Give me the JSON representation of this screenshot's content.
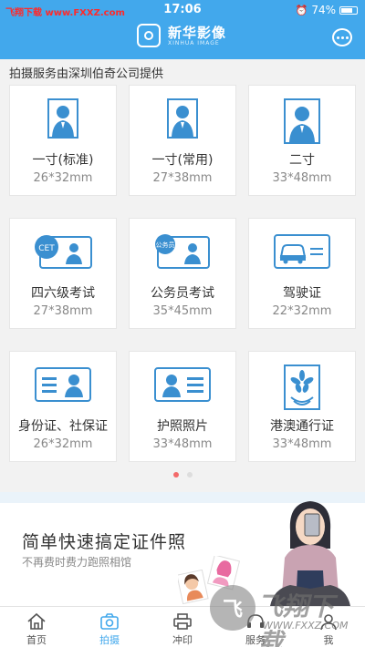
{
  "status_bar": {
    "watermark": "飞翔下载 www.FXXZ.com",
    "time": "17:06",
    "battery": "74%",
    "battery_level": 0.74
  },
  "header": {
    "logo_cn": "新华影像",
    "logo_en": "XINHUA IMAGE"
  },
  "provider_text": "拍摄服务由深圳伯奇公司提供",
  "cards": [
    {
      "title": "一寸(标准)",
      "size": "26*32mm",
      "icon": "person-portrait-icon"
    },
    {
      "title": "一寸(常用)",
      "size": "27*38mm",
      "icon": "person-portrait-icon"
    },
    {
      "title": "二寸",
      "size": "33*48mm",
      "icon": "person-portrait-icon"
    },
    {
      "title": "四六级考试",
      "size": "27*38mm",
      "icon": "cet-card-icon",
      "badge": "CET"
    },
    {
      "title": "公务员考试",
      "size": "35*45mm",
      "icon": "civil-servant-card-icon",
      "badge": "公务员"
    },
    {
      "title": "驾驶证",
      "size": "22*32mm",
      "icon": "car-license-icon"
    },
    {
      "title": "身份证、社保证",
      "size": "26*32mm",
      "icon": "id-card-icon"
    },
    {
      "title": "护照照片",
      "size": "33*48mm",
      "icon": "passport-card-icon"
    },
    {
      "title": "港澳通行证",
      "size": "33*48mm",
      "icon": "bauhinia-card-icon"
    }
  ],
  "carousel": {
    "page_count": 2,
    "active_index": 0
  },
  "banner": {
    "title": "简单快速搞定证件照",
    "subtitle": "不再费时费力跑照相馆"
  },
  "tabbar": [
    {
      "label": "首页",
      "icon": "home-icon",
      "active": false
    },
    {
      "label": "拍摄",
      "icon": "camera-icon",
      "active": true
    },
    {
      "label": "冲印",
      "icon": "printer-icon",
      "active": false
    },
    {
      "label": "服务",
      "icon": "service-icon",
      "active": false
    },
    {
      "label": "我",
      "icon": "user-icon",
      "active": false
    }
  ],
  "watermark": {
    "text": "飞翔下载",
    "url": "WWW.FXXZ.COM"
  },
  "colors": {
    "primary": "#42a8ec",
    "dot_active": "#f36a6a"
  }
}
